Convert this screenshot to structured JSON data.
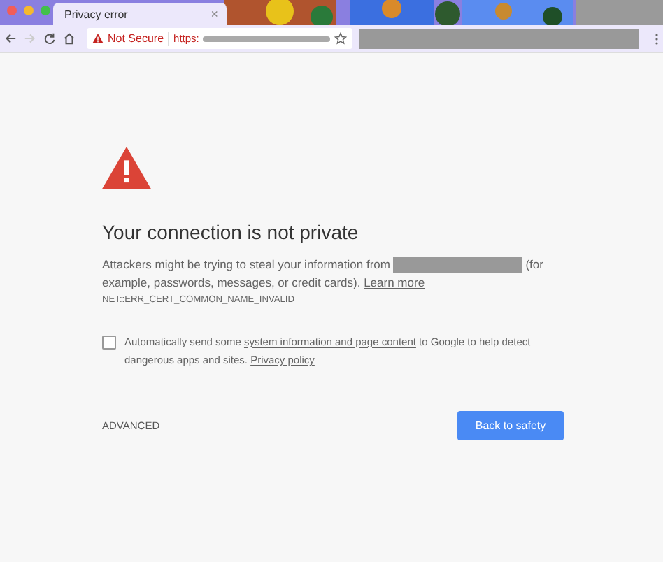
{
  "window": {
    "title": "Privacy error",
    "tab_close": "×"
  },
  "toolbar": {
    "security_label": "Not Secure",
    "url_scheme": "https:",
    "url_redacted": true,
    "extension_bar_redacted": true
  },
  "page": {
    "heading": "Your connection is not private",
    "message_before": "Attackers might be trying to steal your information from",
    "message_redacted": true,
    "message_after": "(for example, passwords, messages, or credit cards).",
    "learn_more": "Learn more",
    "error_code": "NET::ERR_CERT_COMMON_NAME_INVALID",
    "report": {
      "checked": false,
      "text_before": "Automatically send some",
      "link": "system information and page content",
      "text_middle": "to Google to help detect dangerous apps and sites.",
      "privacy_link": "Privacy policy"
    },
    "advanced": "ADVANCED",
    "back_button": "Back to safety"
  }
}
